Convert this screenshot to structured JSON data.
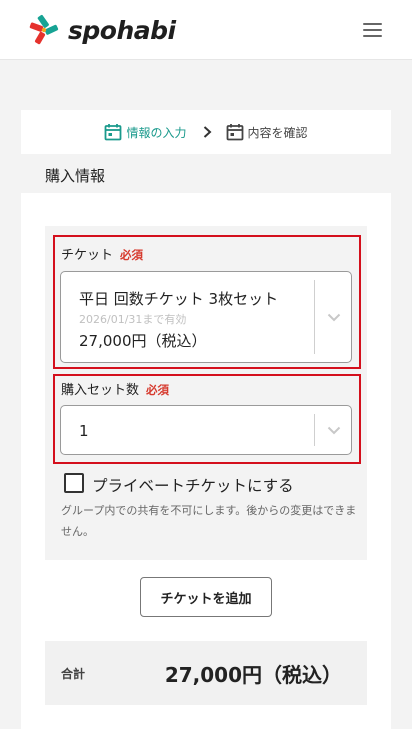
{
  "header": {
    "logo_text": "spohabi",
    "brand_colors": {
      "teal": "#17a394",
      "red": "#e5322d",
      "orange": "#f2a71e"
    },
    "menu_icon": "hamburger-menu-icon"
  },
  "steps": {
    "step1_label": "情報の入力",
    "step2_label": "内容を確認",
    "active_color": "#1a9a8c"
  },
  "section": {
    "title": "購入情報"
  },
  "ticket_field": {
    "label": "チケット",
    "required": "必須",
    "selected_name": "平日 回数チケット 3枚セット",
    "valid_until": "2026/01/31まで有効",
    "price": "27,000円（税込）"
  },
  "quantity_field": {
    "label": "購入セット数",
    "required": "必須",
    "value": "1"
  },
  "private_option": {
    "label": "プライベートチケットにする",
    "checked": false,
    "note": "グループ内での共有を不可にします。後からの変更はできません。"
  },
  "add_button": {
    "label": "チケットを追加"
  },
  "total": {
    "label": "合計",
    "value": "27,000円（税込）"
  },
  "highlight_color": "#d40f1c"
}
